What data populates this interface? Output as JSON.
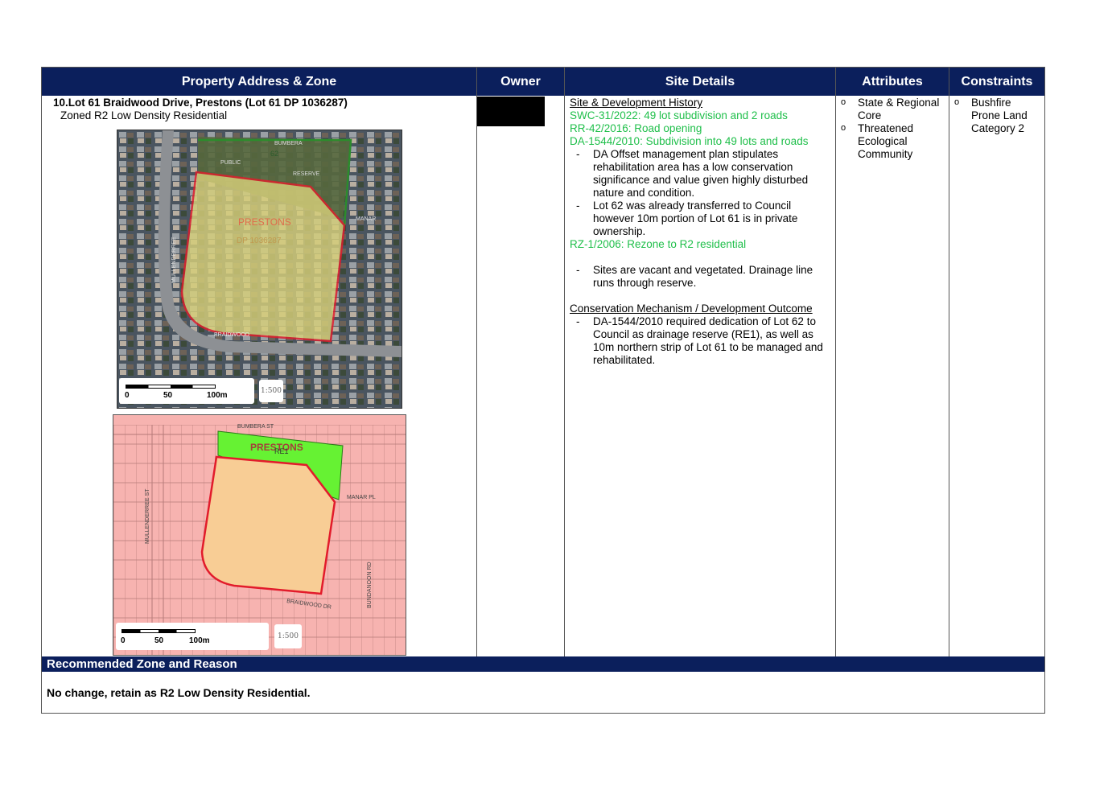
{
  "headers": {
    "property": "Property Address & Zone",
    "owner": "Owner",
    "site_details": "Site Details",
    "attributes": "Attributes",
    "constraints": "Constraints"
  },
  "property": {
    "number": "10.",
    "address": "Lot 61 Braidwood Drive, Prestons (Lot 61 DP 1036287)",
    "zone": "Zoned R2 Low Density Residential"
  },
  "aerial_map": {
    "street_labels": [
      "BUMBERA",
      "PUBLIC",
      "RESERVE",
      "MANAR",
      "BRAIDWOOD",
      "MULLENDERREE"
    ],
    "overlay_labels": [
      "PRESTONS",
      "DP 1036287",
      "62"
    ],
    "scale_labels": [
      "0",
      "50",
      "100m"
    ],
    "scale_ratio": "1:500"
  },
  "zoning_map": {
    "street_labels": [
      "BUMBERA ST",
      "MULLENDERREE ST",
      "MANAR PL",
      "BUNDANOON RD",
      "BRAIDWOOD DR"
    ],
    "overlay_labels": [
      "PRESTONS",
      "RE1"
    ],
    "scale_labels": [
      "0",
      "50",
      "100m"
    ],
    "scale_ratio": "1:500"
  },
  "site_details": {
    "history_heading": "Site & Development History",
    "approvals": [
      "SWC-31/2022: 49 lot subdivision and 2 roads",
      "RR-42/2016: Road opening",
      "DA-1544/2010: Subdivision into 49 lots and roads"
    ],
    "da_notes": [
      "DA Offset management plan stipulates rehabilitation area has a low conservation significance and value given highly disturbed nature and condition.",
      "Lot 62 was already transferred to Council however 10m portion of Lot 61 is in private ownership."
    ],
    "rezone": "RZ-1/2006: Rezone to R2 residential",
    "site_note": "Sites are vacant and vegetated. Drainage line runs through reserve.",
    "mechanism_heading": "Conservation Mechanism / Development Outcome",
    "mechanism_notes": [
      "DA-1544/2010 required dedication of Lot 62 to Council as drainage reserve (RE1), as well as 10m northern strip of Lot 61 to be managed and rehabilitated."
    ]
  },
  "attributes": [
    "State & Regional Core",
    "Threatened Ecological Community"
  ],
  "constraints": [
    "Bushfire Prone Land Category 2"
  ],
  "recommendation": {
    "heading": "Recommended Zone and Reason",
    "text": "No change, retain as R2 Low Density Residential."
  },
  "colors": {
    "header_bg": "#0b1f5c",
    "approval_text": "#1fbf4a",
    "zone_r2": "#f7b3b0",
    "zone_re1": "#66f233",
    "site_fill": "#f8cd95",
    "site_outline": "#e21b2b"
  }
}
